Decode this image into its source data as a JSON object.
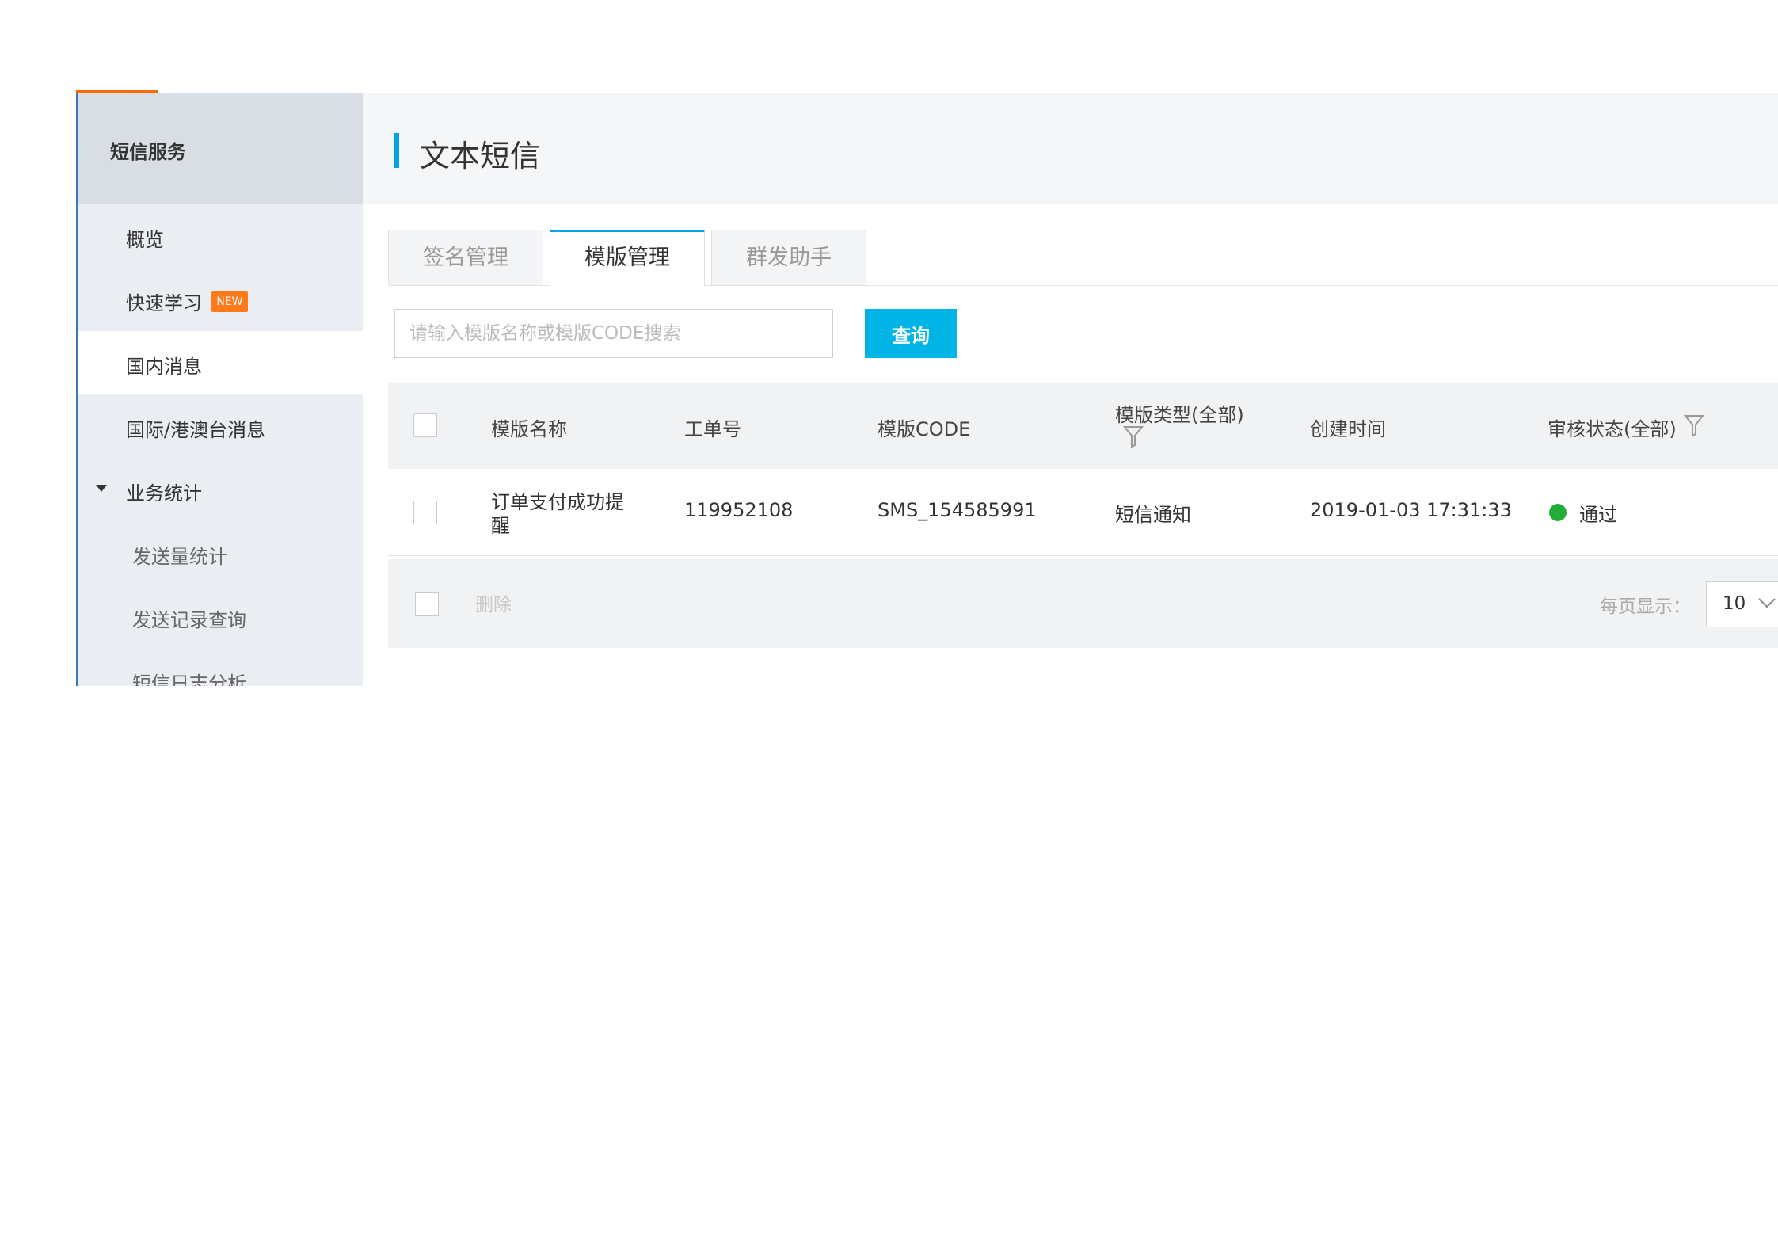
{
  "sidebar": {
    "header": "短信服务",
    "items": [
      {
        "label": "概览"
      },
      {
        "label": "快速学习",
        "badge": "NEW"
      },
      {
        "label": "国内消息"
      },
      {
        "label": "国际/港澳台消息"
      },
      {
        "label": "业务统计"
      },
      {
        "label": "发送量统计"
      },
      {
        "label": "发送记录查询"
      },
      {
        "label": "短信日志分析"
      }
    ]
  },
  "header": {
    "title": "文本短信"
  },
  "tabs": [
    {
      "label": "签名管理"
    },
    {
      "label": "模版管理"
    },
    {
      "label": "群发助手"
    }
  ],
  "search": {
    "placeholder": "请输入模版名称或模版CODE搜索",
    "button": "查询"
  },
  "table": {
    "columns": {
      "name": "模版名称",
      "ticket": "工单号",
      "code": "模版CODE",
      "type": "模版类型(全部)",
      "created": "创建时间",
      "status": "审核状态(全部)"
    },
    "rows": [
      {
        "name_line1": "订单支付成功提",
        "name_line2": "醒",
        "ticket": "119952108",
        "code": "SMS_154585991",
        "type": "短信通知",
        "created": "2019-01-03 17:31:33",
        "status": "通过"
      }
    ]
  },
  "footer": {
    "delete": "删除",
    "per_page_label": "每页显示：",
    "per_page_value": "10"
  },
  "colors": {
    "accent": "#00a2e8",
    "button": "#00b5e5",
    "badge": "#ff7a1a",
    "status_pass": "#22ac38",
    "top_accent": "#ff6a00"
  }
}
